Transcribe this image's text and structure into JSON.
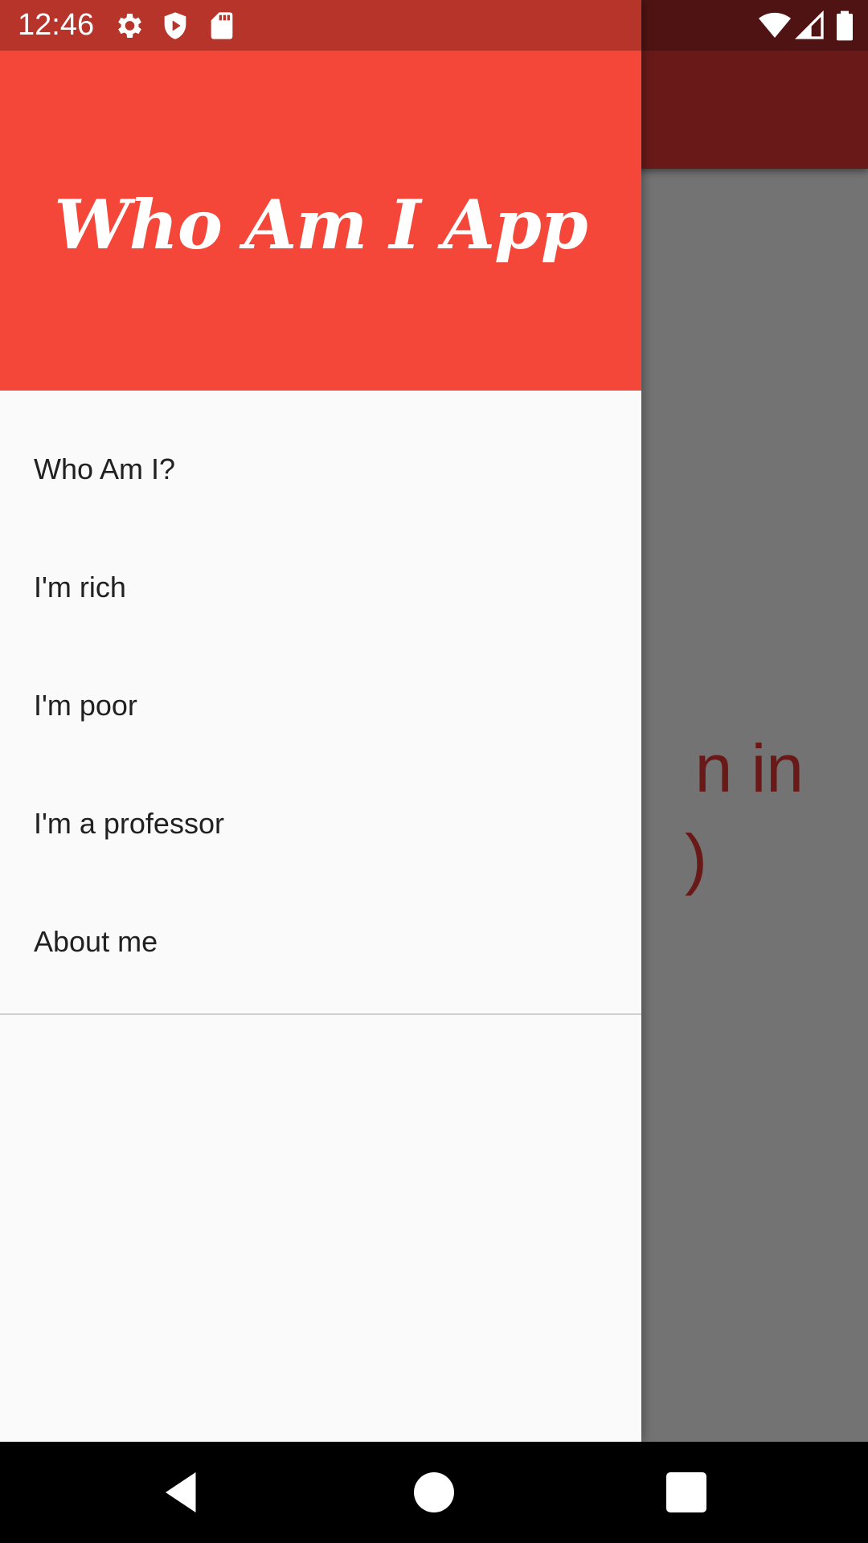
{
  "status_bar": {
    "time": "12:46",
    "left_icons": [
      "gear-icon",
      "shield-play-icon",
      "sd-card-icon"
    ],
    "right_icons": [
      "wifi-icon",
      "cell-signal-icon",
      "battery-icon"
    ]
  },
  "background_app": {
    "body_text_visible": "n in\n)",
    "accent_color": "#e53935"
  },
  "drawer": {
    "header_title": "Who Am I App",
    "header_color": "#f44639",
    "items": [
      {
        "label": "Who Am I?"
      },
      {
        "label": "I'm rich"
      },
      {
        "label": "I'm poor"
      },
      {
        "label": "I'm a professor"
      },
      {
        "label": "About me"
      }
    ]
  },
  "nav_bar": {
    "buttons": [
      "back-icon",
      "home-icon",
      "recents-icon"
    ]
  }
}
